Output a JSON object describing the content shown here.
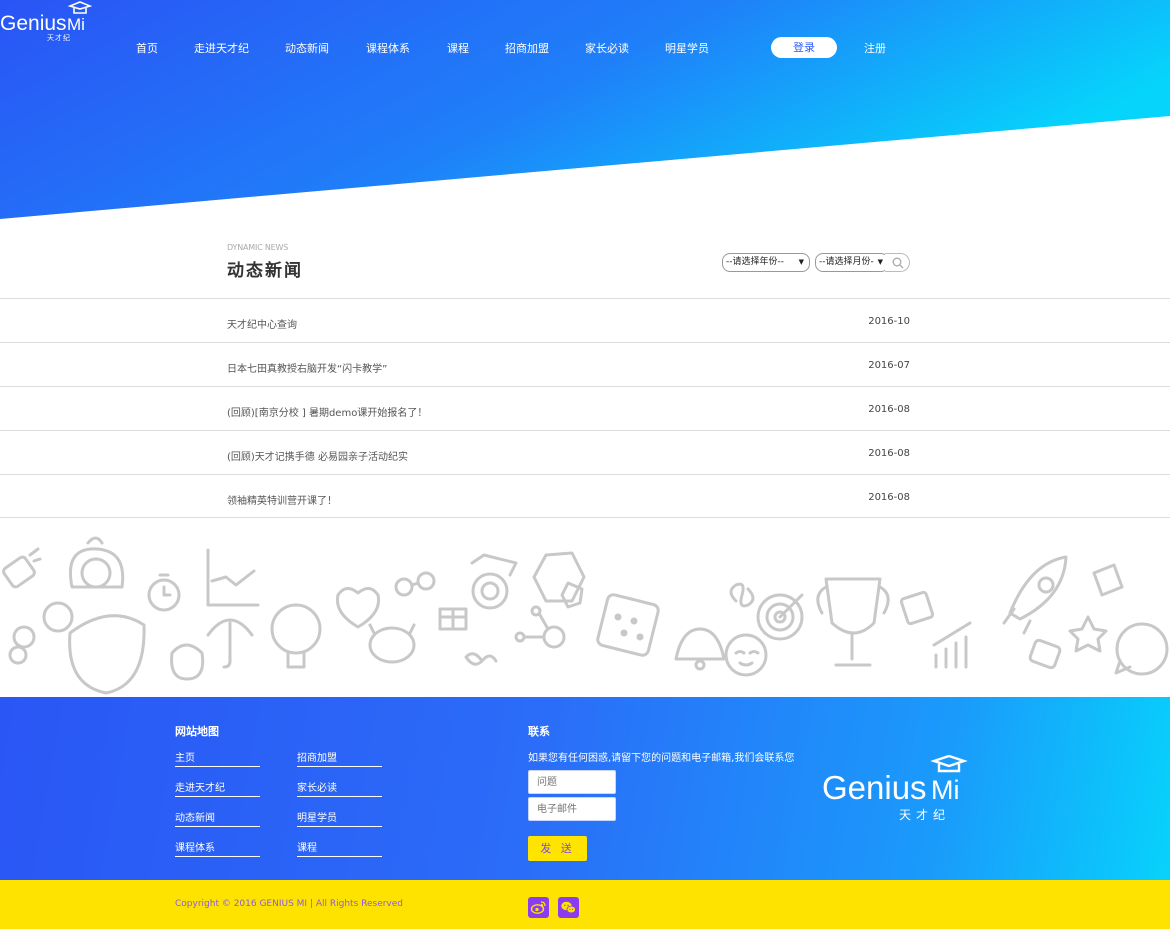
{
  "nav": {
    "items": [
      "首页",
      "走进天才纪",
      "动态新闻",
      "课程体系",
      "课程",
      "招商加盟",
      "家长必读",
      "明星学员"
    ],
    "login": "登录",
    "register": "注册"
  },
  "brand": {
    "name_left": "Genius",
    "name_right": "Mi",
    "name_zh": "天才纪"
  },
  "news": {
    "subtitle_en": "DYNAMIC NEWS",
    "title": "动态新闻",
    "year_select": "--请选择年份--",
    "month_select": "--请选择月份-",
    "items": [
      {
        "title": "天才纪中心查询",
        "date": "2016-10"
      },
      {
        "title": "日本七田真教授右脑开发“闪卡教学”",
        "date": "2016-07"
      },
      {
        "title": "(回顾)[南京分校 ] 暑期demo课开始报名了！",
        "date": "2016-08"
      },
      {
        "title": "(回顾)天才记携手德 必易园亲子活动纪实",
        "date": "2016-08"
      },
      {
        "title": "领袖精英特训营开课了！",
        "date": "2016-08"
      }
    ]
  },
  "footer": {
    "sitemap_title": "网站地图",
    "links": [
      "主页",
      "招商加盟",
      "走进天才纪",
      "家长必读",
      "动态新闻",
      "明星学员",
      "课程体系",
      "课程"
    ],
    "contact_title": "联系",
    "contact_desc": "如果您有任何困惑,请留下您的问题和电子邮箱,我们会联系您",
    "question_placeholder": "问题",
    "email_placeholder": "电子邮件",
    "send": "发 送",
    "copyright": "Copyright © 2016 GENIUS MI | All Rights Reserved"
  },
  "colors": {
    "hero_gradient_start": "#2a54f5",
    "hero_gradient_end": "#06d4fb",
    "bottom_bar": "#ffe300",
    "social_icon_bg": "#8b3cf0",
    "send_button": "#ffe400"
  },
  "icons": [
    "search-icon",
    "weibo-icon",
    "wechat-icon",
    "graduation-cap-icon"
  ]
}
